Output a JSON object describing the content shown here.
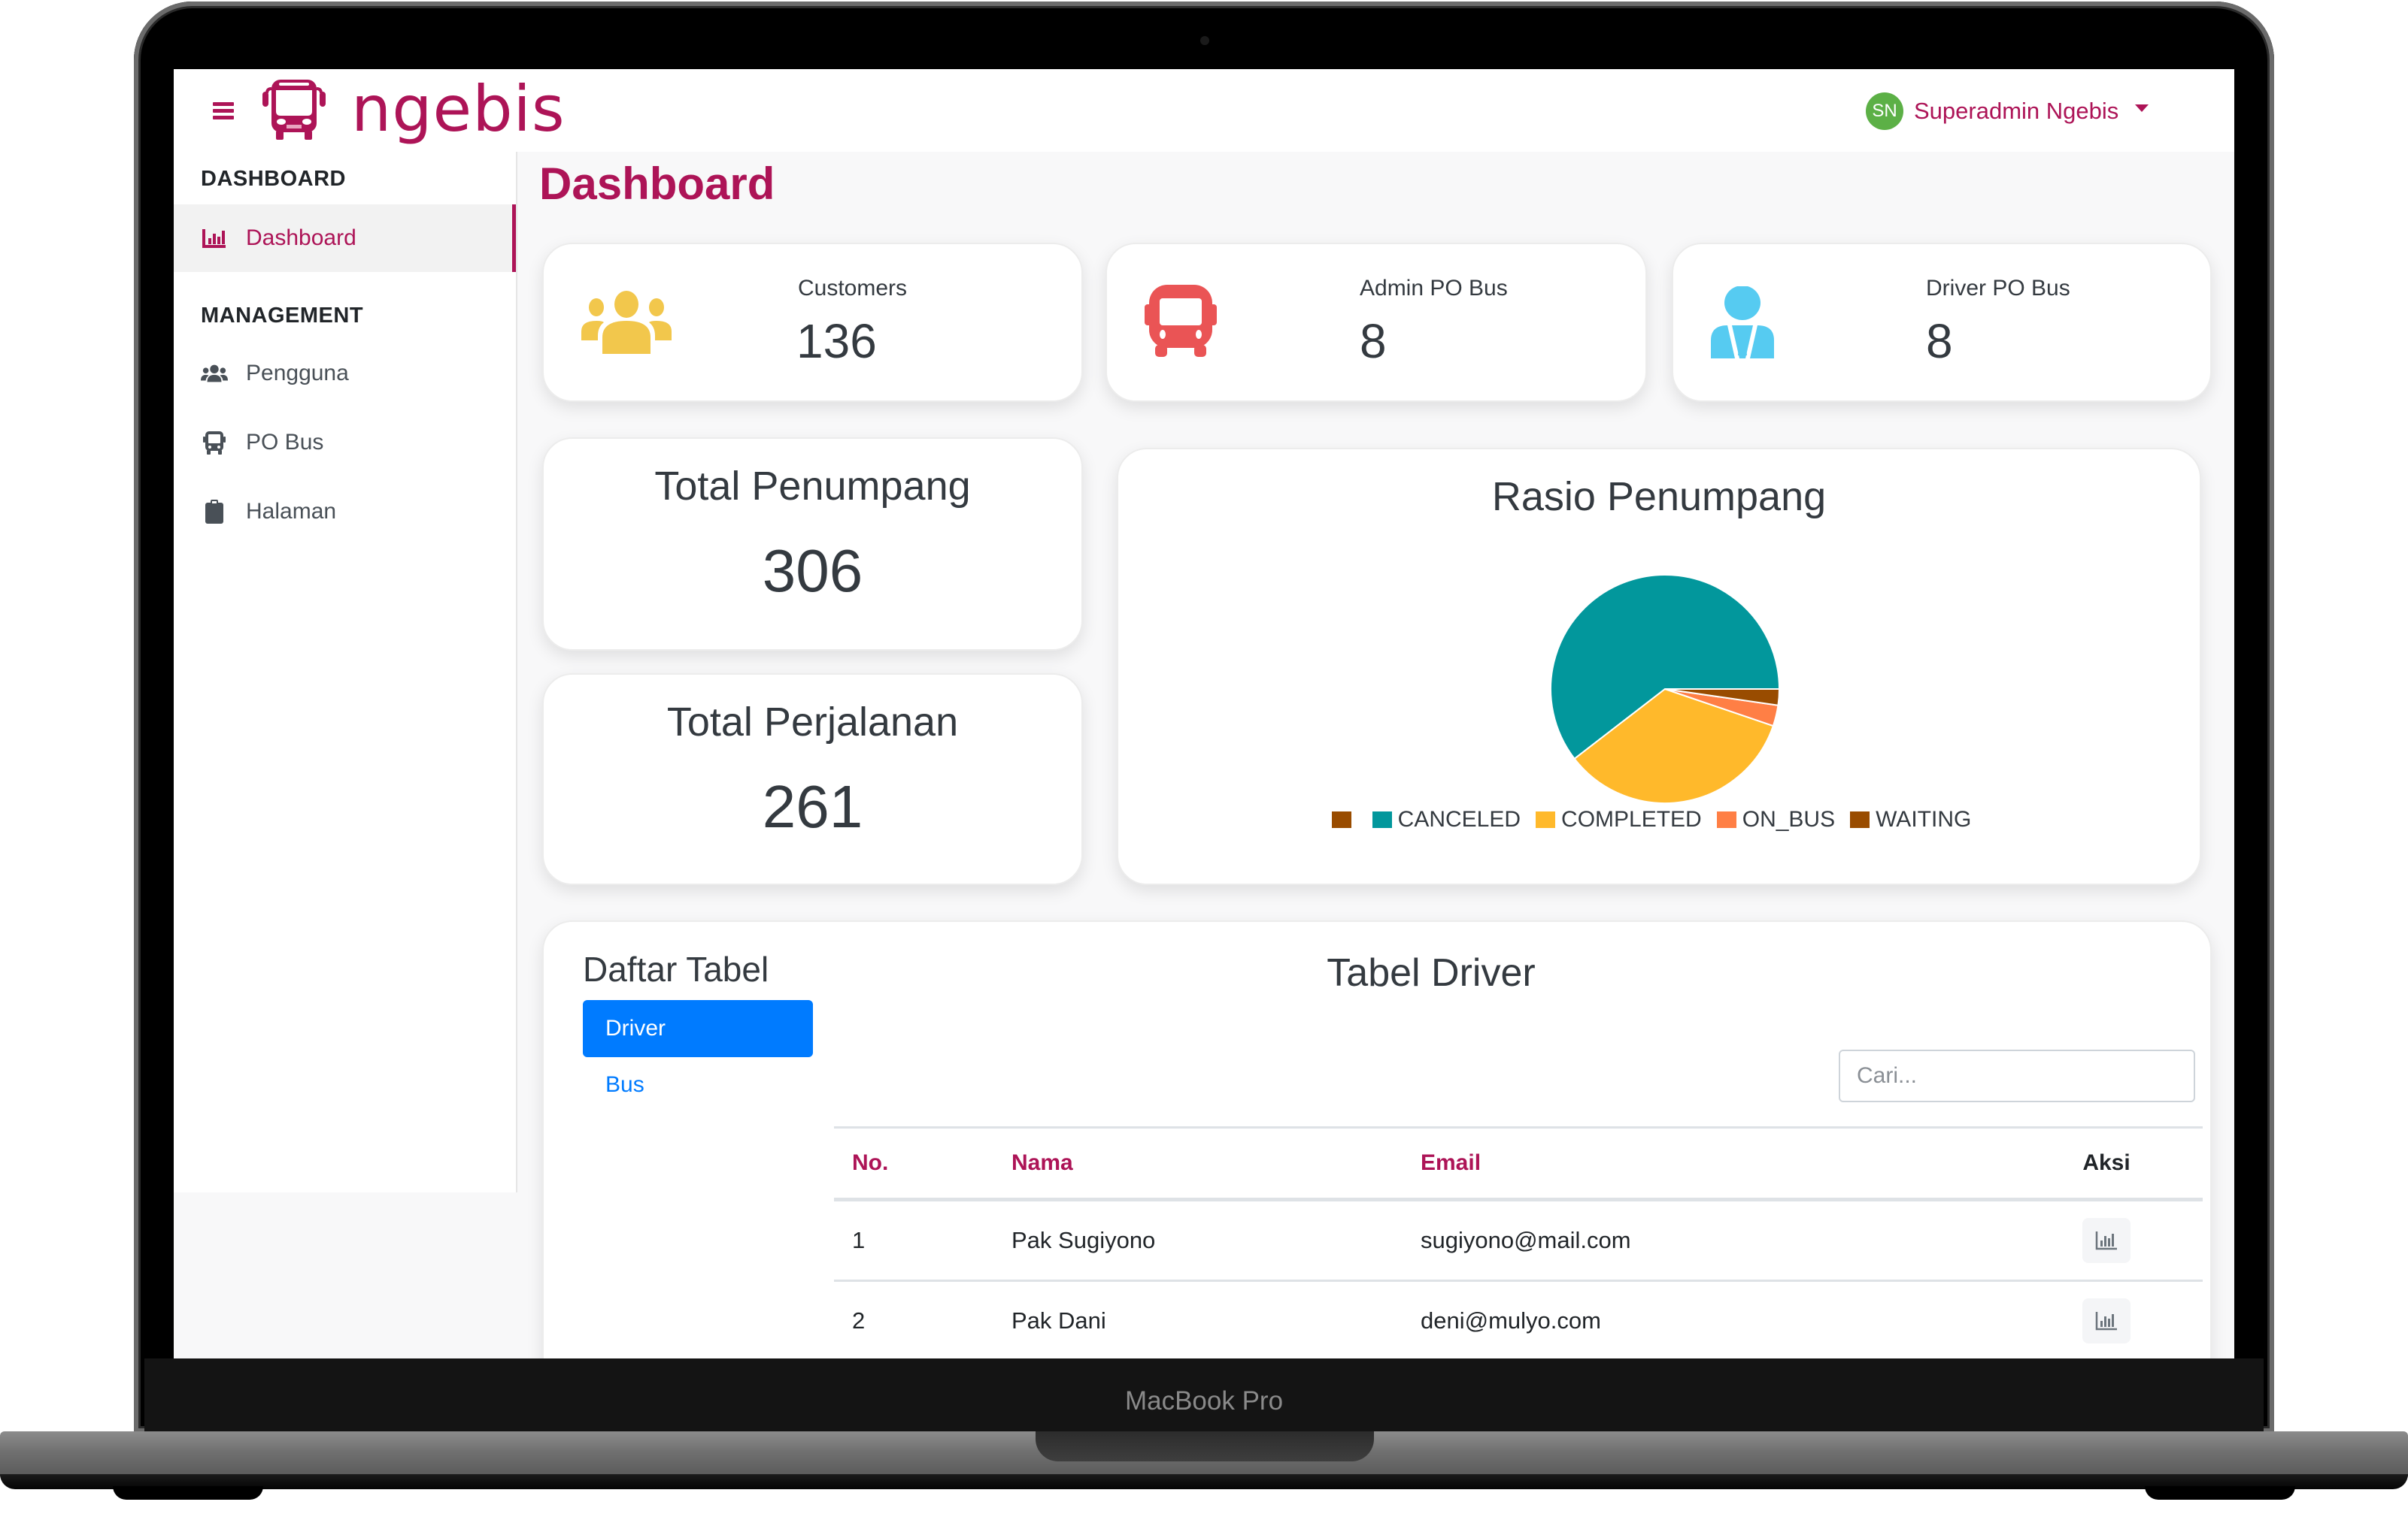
{
  "device": {
    "label": "MacBook Pro"
  },
  "topbar": {
    "brand": "ngebis",
    "user": {
      "initials": "SN",
      "name": "Superadmin Ngebis"
    }
  },
  "sidebar": {
    "sections": [
      {
        "heading": "DASHBOARD",
        "items": [
          {
            "label": "Dashboard",
            "icon": "chart-bar-icon",
            "active": true
          }
        ]
      },
      {
        "heading": "MANAGEMENT",
        "items": [
          {
            "label": "Pengguna",
            "icon": "users-icon",
            "active": false
          },
          {
            "label": "PO Bus",
            "icon": "bus-icon",
            "active": false
          },
          {
            "label": "Halaman",
            "icon": "clipboard-icon",
            "active": false
          }
        ]
      }
    ]
  },
  "page": {
    "title": "Dashboard"
  },
  "stats": [
    {
      "label": "Customers",
      "value": "136",
      "icon": "users-icon",
      "color": "#f2c74c"
    },
    {
      "label": "Admin PO Bus",
      "value": "8",
      "icon": "bus-icon",
      "color": "#ea5455"
    },
    {
      "label": "Driver PO Bus",
      "value": "8",
      "icon": "user-tie-icon",
      "color": "#56cbf1"
    }
  ],
  "totals": [
    {
      "title": "Total Penumpang",
      "value": "306"
    },
    {
      "title": "Total Perjalanan",
      "value": "261"
    }
  ],
  "chart_data": {
    "type": "pie",
    "title": "Rasio Penumpang",
    "legend_position": "bottom",
    "legend": [
      {
        "label": "",
        "color": "#994c00"
      },
      {
        "label": "CANCELED",
        "color": "#02979c"
      },
      {
        "label": "COMPLETED",
        "color": "#ffb92b"
      },
      {
        "label": "ON_BUS",
        "color": "#ff7f45"
      },
      {
        "label": "WAITING",
        "color": "#994c00"
      }
    ],
    "slices": [
      {
        "label": "CANCELED",
        "value": 185,
        "color": "#02979c"
      },
      {
        "label": "COMPLETED",
        "value": 105,
        "color": "#ffb92b"
      },
      {
        "label": "ON_BUS",
        "value": 9,
        "color": "#ff7f45"
      },
      {
        "label": "WAITING",
        "value": 7,
        "color": "#994c00"
      }
    ],
    "note": "slice values estimated from slice angles"
  },
  "table_section": {
    "list_title": "Daftar Tabel",
    "tabs": [
      {
        "label": "Driver",
        "active": true
      },
      {
        "label": "Bus",
        "active": false
      }
    ],
    "table_title": "Tabel Driver",
    "search_placeholder": "Cari...",
    "columns": [
      "No.",
      "Nama",
      "Email",
      "Aksi"
    ],
    "rows": [
      {
        "no": "1",
        "nama": "Pak Sugiyono",
        "email": "sugiyono@mail.com",
        "action_icon": "chart-bar-icon"
      },
      {
        "no": "2",
        "nama": "Pak Dani",
        "email": "deni@mulyo.com",
        "action_icon": "chart-bar-icon"
      }
    ]
  },
  "colors": {
    "brand": "#ad1457",
    "primary": "#007bff",
    "avatar": "#5cb046"
  }
}
